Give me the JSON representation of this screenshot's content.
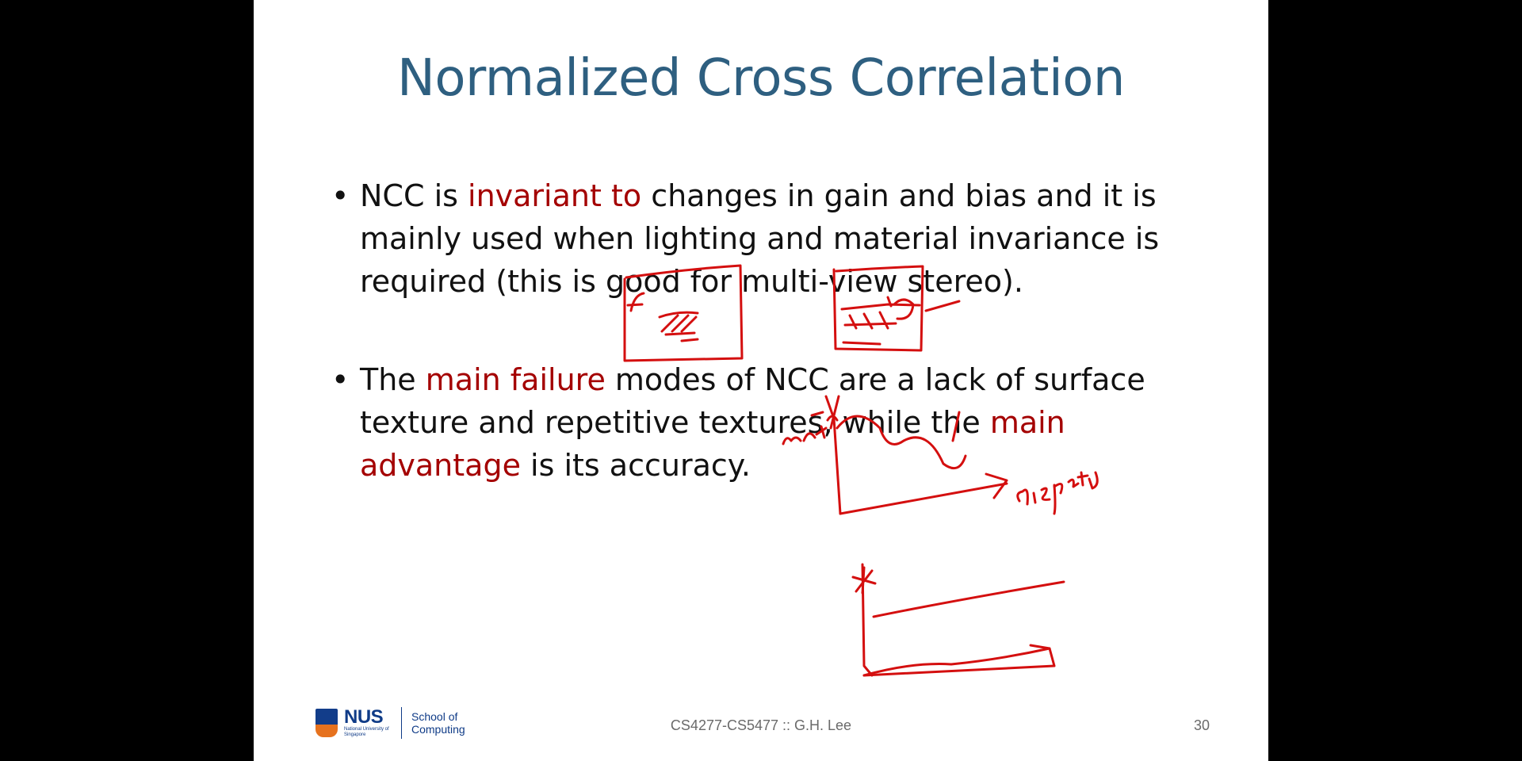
{
  "slide": {
    "title": "Normalized Cross Correlation",
    "bullets": [
      {
        "segments": [
          {
            "text": "NCC is ",
            "highlight": false
          },
          {
            "text": "invariant to",
            "highlight": true
          },
          {
            "text": " changes in gain and bias and it is mainly used when lighting and material invariance is required (this is good for multi-view stereo).",
            "highlight": false
          }
        ]
      },
      {
        "segments": [
          {
            "text": "The ",
            "highlight": false
          },
          {
            "text": "main failure",
            "highlight": true
          },
          {
            "text": " modes of NCC are a lack of surface texture and repetitive textures, while the ",
            "highlight": false
          },
          {
            "text": "main advantage",
            "highlight": true
          },
          {
            "text": " is its accuracy.",
            "highlight": false
          }
        ]
      }
    ],
    "bullet_glyph": "•",
    "footer": {
      "logo_text": "NUS",
      "logo_subtext": "National University of Singapore",
      "school": "School of Computing",
      "course": "CS4277-CS5477 :: G.H. Lee",
      "page_number": "30"
    },
    "colors": {
      "title": "#2e5f80",
      "highlight": "#a40000",
      "annotation_ink": "#d40f0f"
    }
  }
}
